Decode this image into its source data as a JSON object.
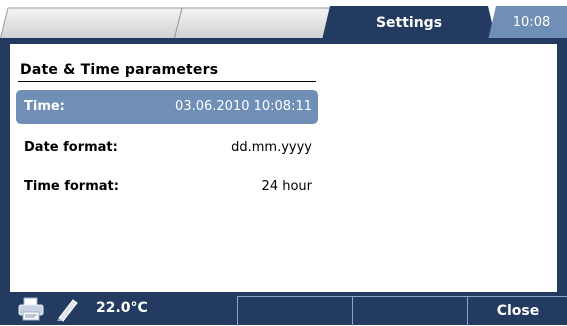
{
  "tabs": [
    {
      "label": ""
    },
    {
      "label": ""
    },
    {
      "label": "Settings"
    }
  ],
  "clock": "10:08",
  "section": {
    "title": "Date & Time parameters"
  },
  "rows": [
    {
      "label": "Time:",
      "value": "03.06.2010 10:08:11",
      "selected": true
    },
    {
      "label": "Date format:",
      "value": "dd.mm.yyyy",
      "selected": false
    },
    {
      "label": "Time format:",
      "value": "24 hour",
      "selected": false
    }
  ],
  "status": {
    "printer_icon": "printer-icon",
    "pen_icon": "pen-icon",
    "temperature": "22.0°C"
  },
  "softkeys": [
    {
      "label": ""
    },
    {
      "label": ""
    },
    {
      "label": ""
    },
    {
      "label": "Close"
    }
  ],
  "colors": {
    "frame": "#233b61",
    "selected_row": "#6f8fb7",
    "inactive_tab": "#d9d9d9"
  }
}
